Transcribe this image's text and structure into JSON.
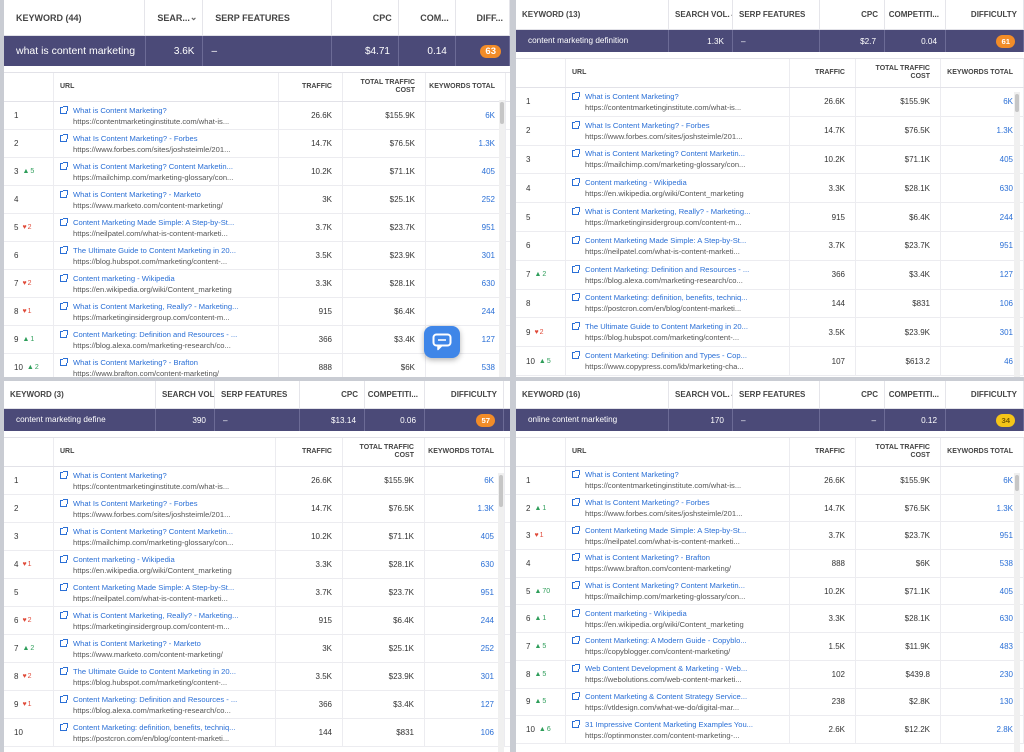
{
  "colors": {
    "accent": "#4b4a78",
    "link": "#2a6fd6",
    "difficulty_orange": "#f28c28",
    "difficulty_yellow": "#f5c518",
    "up": "#2e9e5a",
    "down": "#e04b3a"
  },
  "panels": [
    {
      "header": {
        "keyword": "KEYWORD (44)",
        "search_vol": "SEAR...",
        "serp": "SERP FEATURES",
        "cpc": "CPC",
        "competition": "COM...",
        "difficulty": "DIFF..."
      },
      "keyword_row": {
        "keyword": "what is content marketing",
        "search_vol": "3.6K",
        "serp": "–",
        "cpc": "$4.71",
        "competition": "0.14",
        "difficulty": "63"
      },
      "grid_header": {
        "url": "URL",
        "traffic": "TRAFFIC",
        "traffic_cost": "TOTAL TRAFFIC COST",
        "keywords": "KEYWORDS TOTAL"
      },
      "rows": [
        {
          "pos": "1",
          "change": "",
          "dir": "",
          "title": "What is Content Marketing?",
          "url": "https://contentmarketinginstitute.com/what-is...",
          "traffic": "26.6K",
          "cost": "$155.9K",
          "keywords": "6K"
        },
        {
          "pos": "2",
          "change": "",
          "dir": "",
          "title": "What Is Content Marketing? - Forbes",
          "url": "https://www.forbes.com/sites/joshsteimle/201...",
          "traffic": "14.7K",
          "cost": "$76.5K",
          "keywords": "1.3K"
        },
        {
          "pos": "3",
          "change": "5",
          "dir": "up",
          "title": "What is Content Marketing? Content Marketin...",
          "url": "https://mailchimp.com/marketing-glossary/con...",
          "traffic": "10.2K",
          "cost": "$71.1K",
          "keywords": "405"
        },
        {
          "pos": "4",
          "change": "",
          "dir": "",
          "title": "What is Content Marketing? - Marketo",
          "url": "https://www.marketo.com/content-marketing/",
          "traffic": "3K",
          "cost": "$25.1K",
          "keywords": "252"
        },
        {
          "pos": "5",
          "change": "2",
          "dir": "dn",
          "title": "Content Marketing Made Simple: A Step-by-St...",
          "url": "https://neilpatel.com/what-is-content-marketi...",
          "traffic": "3.7K",
          "cost": "$23.7K",
          "keywords": "951"
        },
        {
          "pos": "6",
          "change": "",
          "dir": "",
          "title": "The Ultimate Guide to Content Marketing in 20...",
          "url": "https://blog.hubspot.com/marketing/content-...",
          "traffic": "3.5K",
          "cost": "$23.9K",
          "keywords": "301"
        },
        {
          "pos": "7",
          "change": "2",
          "dir": "dn",
          "title": "Content marketing - Wikipedia",
          "url": "https://en.wikipedia.org/wiki/Content_marketing",
          "traffic": "3.3K",
          "cost": "$28.1K",
          "keywords": "630"
        },
        {
          "pos": "8",
          "change": "1",
          "dir": "dn",
          "title": "What is Content Marketing, Really? - Marketing...",
          "url": "https://marketinginsidergroup.com/content-m...",
          "traffic": "915",
          "cost": "$6.4K",
          "keywords": "244"
        },
        {
          "pos": "9",
          "change": "1",
          "dir": "up",
          "title": "Content Marketing: Definition and Resources - ...",
          "url": "https://blog.alexa.com/marketing-research/co...",
          "traffic": "366",
          "cost": "$3.4K",
          "keywords": "127"
        },
        {
          "pos": "10",
          "change": "2",
          "dir": "up",
          "title": "What is Content Marketing? - Brafton",
          "url": "https://www.brafton.com/content-marketing/",
          "traffic": "888",
          "cost": "$6K",
          "keywords": "538"
        }
      ]
    },
    {
      "header": {
        "keyword": "KEYWORD (13)",
        "search_vol": "SEARCH VOL.",
        "serp": "SERP FEATURES",
        "cpc": "CPC",
        "competition": "COMPETITI...",
        "difficulty": "DIFFICULTY"
      },
      "keyword_row": {
        "keyword": "content marketing definition",
        "search_vol": "1.3K",
        "serp": "–",
        "cpc": "$2.7",
        "competition": "0.04",
        "difficulty": "61"
      },
      "grid_header": {
        "url": "URL",
        "traffic": "TRAFFIC",
        "traffic_cost": "TOTAL TRAFFIC COST",
        "keywords": "KEYWORDS TOTAL"
      },
      "rows": [
        {
          "pos": "1",
          "change": "",
          "dir": "",
          "title": "What is Content Marketing?",
          "url": "https://contentmarketinginstitute.com/what-is...",
          "traffic": "26.6K",
          "cost": "$155.9K",
          "keywords": "6K"
        },
        {
          "pos": "2",
          "change": "",
          "dir": "",
          "title": "What Is Content Marketing? - Forbes",
          "url": "https://www.forbes.com/sites/joshsteimle/201...",
          "traffic": "14.7K",
          "cost": "$76.5K",
          "keywords": "1.3K"
        },
        {
          "pos": "3",
          "change": "",
          "dir": "",
          "title": "What is Content Marketing? Content Marketin...",
          "url": "https://mailchimp.com/marketing-glossary/con...",
          "traffic": "10.2K",
          "cost": "$71.1K",
          "keywords": "405"
        },
        {
          "pos": "4",
          "change": "",
          "dir": "",
          "title": "Content marketing - Wikipedia",
          "url": "https://en.wikipedia.org/wiki/Content_marketing",
          "traffic": "3.3K",
          "cost": "$28.1K",
          "keywords": "630"
        },
        {
          "pos": "5",
          "change": "",
          "dir": "",
          "title": "What is Content Marketing, Really? - Marketing...",
          "url": "https://marketinginsidergroup.com/content-m...",
          "traffic": "915",
          "cost": "$6.4K",
          "keywords": "244"
        },
        {
          "pos": "6",
          "change": "",
          "dir": "",
          "title": "Content Marketing Made Simple: A Step-by-St...",
          "url": "https://neilpatel.com/what-is-content-marketi...",
          "traffic": "3.7K",
          "cost": "$23.7K",
          "keywords": "951"
        },
        {
          "pos": "7",
          "change": "2",
          "dir": "up",
          "title": "Content Marketing: Definition and Resources - ...",
          "url": "https://blog.alexa.com/marketing-research/co...",
          "traffic": "366",
          "cost": "$3.4K",
          "keywords": "127"
        },
        {
          "pos": "8",
          "change": "",
          "dir": "",
          "title": "Content Marketing: definition, benefits, techniq...",
          "url": "https://postcron.com/en/blog/content-marketi...",
          "traffic": "144",
          "cost": "$831",
          "keywords": "106"
        },
        {
          "pos": "9",
          "change": "2",
          "dir": "dn",
          "title": "The Ultimate Guide to Content Marketing in 20...",
          "url": "https://blog.hubspot.com/marketing/content-...",
          "traffic": "3.5K",
          "cost": "$23.9K",
          "keywords": "301"
        },
        {
          "pos": "10",
          "change": "5",
          "dir": "up",
          "title": "Content Marketing: Definition and Types - Cop...",
          "url": "https://www.copypress.com/kb/marketing-cha...",
          "traffic": "107",
          "cost": "$613.2",
          "keywords": "46"
        }
      ]
    },
    {
      "header": {
        "keyword": "KEYWORD (3)",
        "search_vol": "SEARCH VOL.",
        "serp": "SERP FEATURES",
        "cpc": "CPC",
        "competition": "COMPETITI...",
        "difficulty": "DIFFICULTY"
      },
      "keyword_row": {
        "keyword": "content marketing define",
        "search_vol": "390",
        "serp": "–",
        "cpc": "$13.14",
        "competition": "0.06",
        "difficulty": "57"
      },
      "grid_header": {
        "url": "URL",
        "traffic": "TRAFFIC",
        "traffic_cost": "TOTAL TRAFFIC COST",
        "keywords": "KEYWORDS TOTAL"
      },
      "rows": [
        {
          "pos": "1",
          "change": "",
          "dir": "",
          "title": "What is Content Marketing?",
          "url": "https://contentmarketinginstitute.com/what-is...",
          "traffic": "26.6K",
          "cost": "$155.9K",
          "keywords": "6K"
        },
        {
          "pos": "2",
          "change": "",
          "dir": "",
          "title": "What Is Content Marketing? - Forbes",
          "url": "https://www.forbes.com/sites/joshsteimle/201...",
          "traffic": "14.7K",
          "cost": "$76.5K",
          "keywords": "1.3K"
        },
        {
          "pos": "3",
          "change": "",
          "dir": "",
          "title": "What is Content Marketing? Content Marketin...",
          "url": "https://mailchimp.com/marketing-glossary/con...",
          "traffic": "10.2K",
          "cost": "$71.1K",
          "keywords": "405"
        },
        {
          "pos": "4",
          "change": "1",
          "dir": "dn",
          "title": "Content marketing - Wikipedia",
          "url": "https://en.wikipedia.org/wiki/Content_marketing",
          "traffic": "3.3K",
          "cost": "$28.1K",
          "keywords": "630"
        },
        {
          "pos": "5",
          "change": "",
          "dir": "",
          "title": "Content Marketing Made Simple: A Step-by-St...",
          "url": "https://neilpatel.com/what-is-content-marketi...",
          "traffic": "3.7K",
          "cost": "$23.7K",
          "keywords": "951"
        },
        {
          "pos": "6",
          "change": "2",
          "dir": "dn",
          "title": "What is Content Marketing, Really? - Marketing...",
          "url": "https://marketinginsidergroup.com/content-m...",
          "traffic": "915",
          "cost": "$6.4K",
          "keywords": "244"
        },
        {
          "pos": "7",
          "change": "2",
          "dir": "up",
          "title": "What is Content Marketing? - Marketo",
          "url": "https://www.marketo.com/content-marketing/",
          "traffic": "3K",
          "cost": "$25.1K",
          "keywords": "252"
        },
        {
          "pos": "8",
          "change": "2",
          "dir": "dn",
          "title": "The Ultimate Guide to Content Marketing in 20...",
          "url": "https://blog.hubspot.com/marketing/content-...",
          "traffic": "3.5K",
          "cost": "$23.9K",
          "keywords": "301"
        },
        {
          "pos": "9",
          "change": "1",
          "dir": "dn",
          "title": "Content Marketing: Definition and Resources - ...",
          "url": "https://blog.alexa.com/marketing-research/co...",
          "traffic": "366",
          "cost": "$3.4K",
          "keywords": "127"
        },
        {
          "pos": "10",
          "change": "",
          "dir": "",
          "title": "Content Marketing: definition, benefits, techniq...",
          "url": "https://postcron.com/en/blog/content-marketi...",
          "traffic": "144",
          "cost": "$831",
          "keywords": "106"
        }
      ]
    },
    {
      "header": {
        "keyword": "KEYWORD (16)",
        "search_vol": "SEARCH VOL.",
        "serp": "SERP FEATURES",
        "cpc": "CPC",
        "competition": "COMPETITI...",
        "difficulty": "DIFFICULTY"
      },
      "keyword_row": {
        "keyword": "online content marketing",
        "search_vol": "170",
        "serp": "–",
        "cpc": "–",
        "competition": "0.12",
        "difficulty": "34"
      },
      "grid_header": {
        "url": "URL",
        "traffic": "TRAFFIC",
        "traffic_cost": "TOTAL TRAFFIC COST",
        "keywords": "KEYWORDS TOTAL"
      },
      "rows": [
        {
          "pos": "1",
          "change": "",
          "dir": "",
          "title": "What is Content Marketing?",
          "url": "https://contentmarketinginstitute.com/what-is...",
          "traffic": "26.6K",
          "cost": "$155.9K",
          "keywords": "6K"
        },
        {
          "pos": "2",
          "change": "1",
          "dir": "up",
          "title": "What Is Content Marketing? - Forbes",
          "url": "https://www.forbes.com/sites/joshsteimle/201...",
          "traffic": "14.7K",
          "cost": "$76.5K",
          "keywords": "1.3K"
        },
        {
          "pos": "3",
          "change": "1",
          "dir": "dn",
          "title": "Content Marketing Made Simple: A Step-by-St...",
          "url": "https://neilpatel.com/what-is-content-marketi...",
          "traffic": "3.7K",
          "cost": "$23.7K",
          "keywords": "951"
        },
        {
          "pos": "4",
          "change": "",
          "dir": "",
          "title": "What is Content Marketing? - Brafton",
          "url": "https://www.brafton.com/content-marketing/",
          "traffic": "888",
          "cost": "$6K",
          "keywords": "538"
        },
        {
          "pos": "5",
          "change": "70",
          "dir": "up",
          "title": "What is Content Marketing? Content Marketin...",
          "url": "https://mailchimp.com/marketing-glossary/con...",
          "traffic": "10.2K",
          "cost": "$71.1K",
          "keywords": "405"
        },
        {
          "pos": "6",
          "change": "1",
          "dir": "up",
          "title": "Content marketing - Wikipedia",
          "url": "https://en.wikipedia.org/wiki/Content_marketing",
          "traffic": "3.3K",
          "cost": "$28.1K",
          "keywords": "630"
        },
        {
          "pos": "7",
          "change": "5",
          "dir": "up",
          "title": "Content Marketing: A Modern Guide - Copyblo...",
          "url": "https://copyblogger.com/content-marketing/",
          "traffic": "1.5K",
          "cost": "$11.9K",
          "keywords": "483"
        },
        {
          "pos": "8",
          "change": "5",
          "dir": "up",
          "title": "Web Content Development & Marketing - Web...",
          "url": "https://webolutions.com/web-content-marketi...",
          "traffic": "102",
          "cost": "$439.8",
          "keywords": "230"
        },
        {
          "pos": "9",
          "change": "5",
          "dir": "up",
          "title": "Content Marketing & Content Strategy Service...",
          "url": "https://vtldesign.com/what-we-do/digital-mar...",
          "traffic": "238",
          "cost": "$2.8K",
          "keywords": "130"
        },
        {
          "pos": "10",
          "change": "6",
          "dir": "up",
          "title": "31 Impressive Content Marketing Examples You...",
          "url": "https://optinmonster.com/content-marketing-...",
          "traffic": "2.6K",
          "cost": "$12.2K",
          "keywords": "2.8K"
        }
      ]
    }
  ],
  "chat_button": {
    "icon": "chat-bubble-icon"
  }
}
